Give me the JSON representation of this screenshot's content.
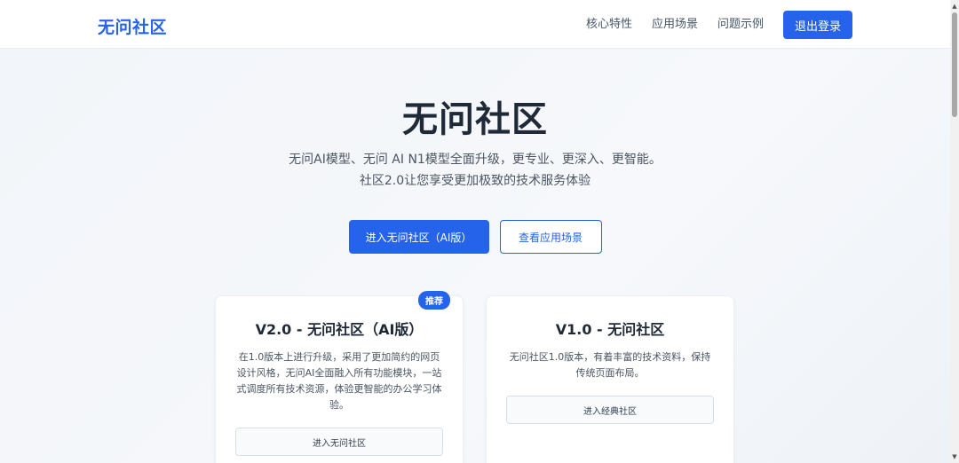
{
  "header": {
    "logo": "无问社区",
    "nav": [
      "核心特性",
      "应用场景",
      "问题示例"
    ],
    "logout_label": "退出登录"
  },
  "hero": {
    "title": "无问社区",
    "subtitle_line1": "无问AI模型、无问 AI N1模型全面升级，更专业、更深入、更智能。",
    "subtitle_line2": "社区2.0让您享受更加极致的技术服务体验",
    "primary_cta": "进入无问社区（AI版）",
    "secondary_cta": "查看应用场景"
  },
  "cards": [
    {
      "badge": "推荐",
      "title": "V2.0 - 无问社区（AI版）",
      "description": "在1.0版本上进行升级，采用了更加简约的网页设计风格，无问AI全面融入所有功能模块，一站式调度所有技术资源，体验更智能的办公学习体验。",
      "button": "进入无问社区"
    },
    {
      "title": "V1.0 - 无问社区",
      "description": "无问社区1.0版本，有着丰富的技术资料，保持传统页面布局。",
      "button": "进入经典社区"
    }
  ],
  "colors": {
    "accent": "#2563eb",
    "title": "#1f2937",
    "text": "#4b5563"
  }
}
